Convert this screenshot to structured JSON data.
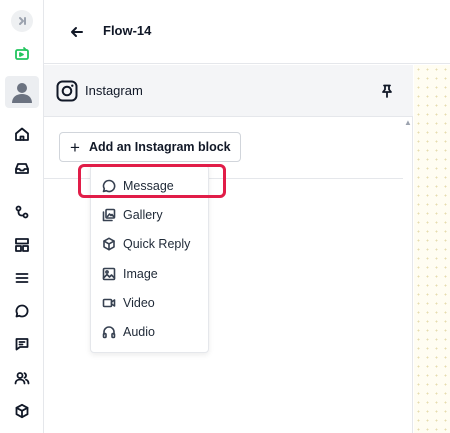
{
  "header": {
    "title": "Flow-14"
  },
  "panel": {
    "title": "Instagram",
    "add_button_label": "Add an Instagram block"
  },
  "menu": {
    "items": [
      {
        "label": "Message",
        "icon": "message-circle-icon"
      },
      {
        "label": "Gallery",
        "icon": "gallery-icon"
      },
      {
        "label": "Quick Reply",
        "icon": "cube-icon"
      },
      {
        "label": "Image",
        "icon": "image-icon"
      },
      {
        "label": "Video",
        "icon": "video-icon"
      },
      {
        "label": "Audio",
        "icon": "headphones-icon"
      }
    ]
  },
  "sidebar": {
    "icons": [
      "collapse-icon",
      "bot-icon",
      "avatar-icon",
      "home-icon",
      "inbox-icon",
      "flows-icon",
      "layout-icon",
      "list-icon",
      "chat-icon",
      "message-square-icon",
      "users-icon",
      "box-icon"
    ]
  },
  "colors": {
    "highlight": "#e11d48",
    "bot_accent": "#22c55e",
    "canvas": "#fffdf2"
  }
}
